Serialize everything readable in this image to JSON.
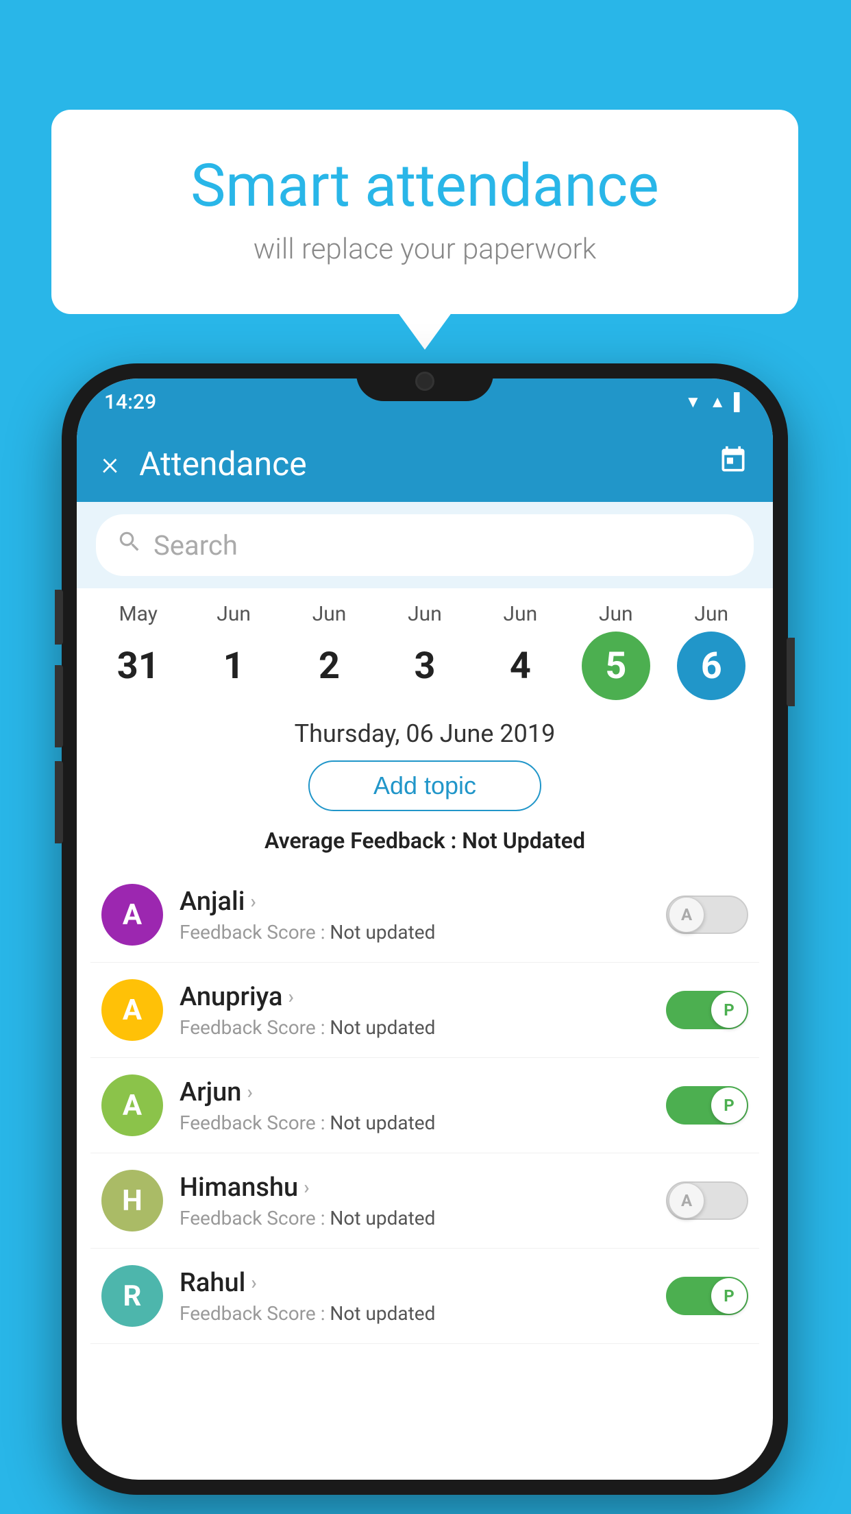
{
  "background_color": "#29b6e8",
  "bubble": {
    "title": "Smart attendance",
    "subtitle": "will replace your paperwork"
  },
  "status_bar": {
    "time": "14:29",
    "icons": [
      "wifi",
      "signal",
      "battery"
    ]
  },
  "app_bar": {
    "title": "Attendance",
    "close_label": "×",
    "calendar_label": "📅"
  },
  "search": {
    "placeholder": "Search"
  },
  "calendar": {
    "items": [
      {
        "month": "May",
        "day": "31",
        "style": "normal"
      },
      {
        "month": "Jun",
        "day": "1",
        "style": "normal"
      },
      {
        "month": "Jun",
        "day": "2",
        "style": "normal"
      },
      {
        "month": "Jun",
        "day": "3",
        "style": "normal"
      },
      {
        "month": "Jun",
        "day": "4",
        "style": "normal"
      },
      {
        "month": "Jun",
        "day": "5",
        "style": "green"
      },
      {
        "month": "Jun",
        "day": "6",
        "style": "blue"
      }
    ]
  },
  "selected_date": "Thursday, 06 June 2019",
  "add_topic_label": "Add topic",
  "avg_feedback_label": "Average Feedback :",
  "avg_feedback_value": "Not Updated",
  "students": [
    {
      "name": "Anjali",
      "avatar_letter": "A",
      "avatar_color": "#9c27b0",
      "score_label": "Feedback Score :",
      "score_value": "Not updated",
      "toggle": "off",
      "toggle_label": "A"
    },
    {
      "name": "Anupriya",
      "avatar_letter": "A",
      "avatar_color": "#ffc107",
      "score_label": "Feedback Score :",
      "score_value": "Not updated",
      "toggle": "on",
      "toggle_label": "P"
    },
    {
      "name": "Arjun",
      "avatar_letter": "A",
      "avatar_color": "#8bc34a",
      "score_label": "Feedback Score :",
      "score_value": "Not updated",
      "toggle": "on",
      "toggle_label": "P"
    },
    {
      "name": "Himanshu",
      "avatar_letter": "H",
      "avatar_color": "#aabb66",
      "score_label": "Feedback Score :",
      "score_value": "Not updated",
      "toggle": "off",
      "toggle_label": "A"
    },
    {
      "name": "Rahul",
      "avatar_letter": "R",
      "avatar_color": "#4db6ac",
      "score_label": "Feedback Score :",
      "score_value": "Not updated",
      "toggle": "on",
      "toggle_label": "P"
    }
  ]
}
